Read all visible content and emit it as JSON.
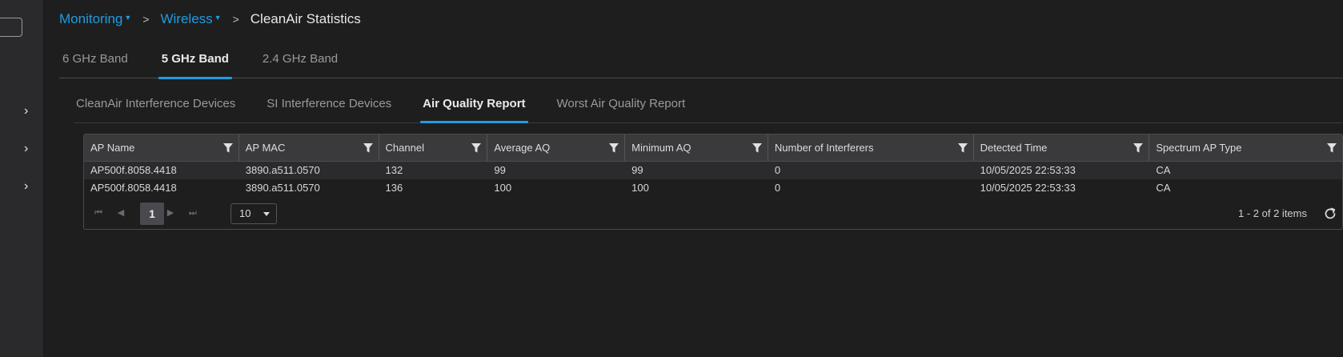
{
  "breadcrumb": {
    "level1": "Monitoring",
    "level2": "Wireless",
    "current": "CleanAir Statistics"
  },
  "band_tabs": [
    "6 GHz Band",
    "5 GHz Band",
    "2.4 GHz Band"
  ],
  "band_tabs_active": "5 GHz Band",
  "sub_tabs": [
    "CleanAir Interference Devices",
    "SI Interference Devices",
    "Air Quality Report",
    "Worst Air Quality Report"
  ],
  "sub_tabs_active": "Air Quality Report",
  "table": {
    "columns": [
      "AP Name",
      "AP MAC",
      "Channel",
      "Average AQ",
      "Minimum AQ",
      "Number of Interferers",
      "Detected Time",
      "Spectrum AP Type"
    ],
    "rows": [
      [
        "AP500f.8058.4418",
        "3890.a511.0570",
        "132",
        "99",
        "99",
        "0",
        "10/05/2025 22:53:33",
        "CA"
      ],
      [
        "AP500f.8058.4418",
        "3890.a511.0570",
        "136",
        "100",
        "100",
        "0",
        "10/05/2025 22:53:33",
        "CA"
      ]
    ]
  },
  "pager": {
    "current_page": "1",
    "page_size": "10",
    "items_text": "1 - 2 of 2 items"
  },
  "colors": {
    "accent": "#1f9de0",
    "background": "#1e1e1f",
    "header_bg": "#3a3a3d"
  }
}
